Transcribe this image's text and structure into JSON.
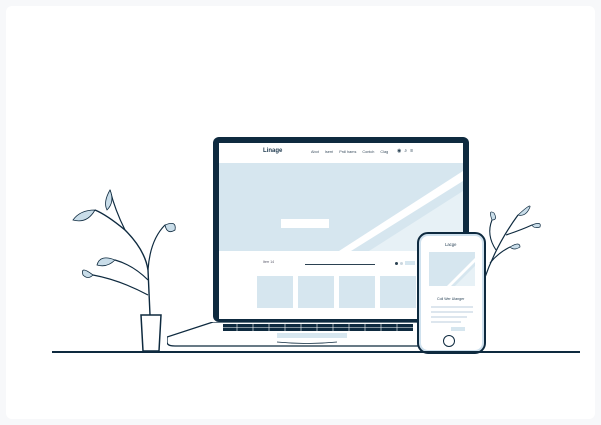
{
  "colors": {
    "ink": "#0e2a3f",
    "pale_blue": "#d6e6ef",
    "background": "#ffffff",
    "leaf": "#c9dde9"
  },
  "laptop": {
    "site": {
      "logo": "Linage",
      "nav_links": [
        "Abot",
        "Iserri",
        "Prdl hams",
        "Contch",
        "Clag"
      ],
      "icons": [
        "toggle-icon",
        "search-icon",
        "menu-icon"
      ],
      "section_label": "Iterr 14"
    }
  },
  "phone": {
    "logo": "Lacge",
    "headline": "Coll Wer Ulanger"
  },
  "plants": [
    "left-plant",
    "right-plant"
  ]
}
